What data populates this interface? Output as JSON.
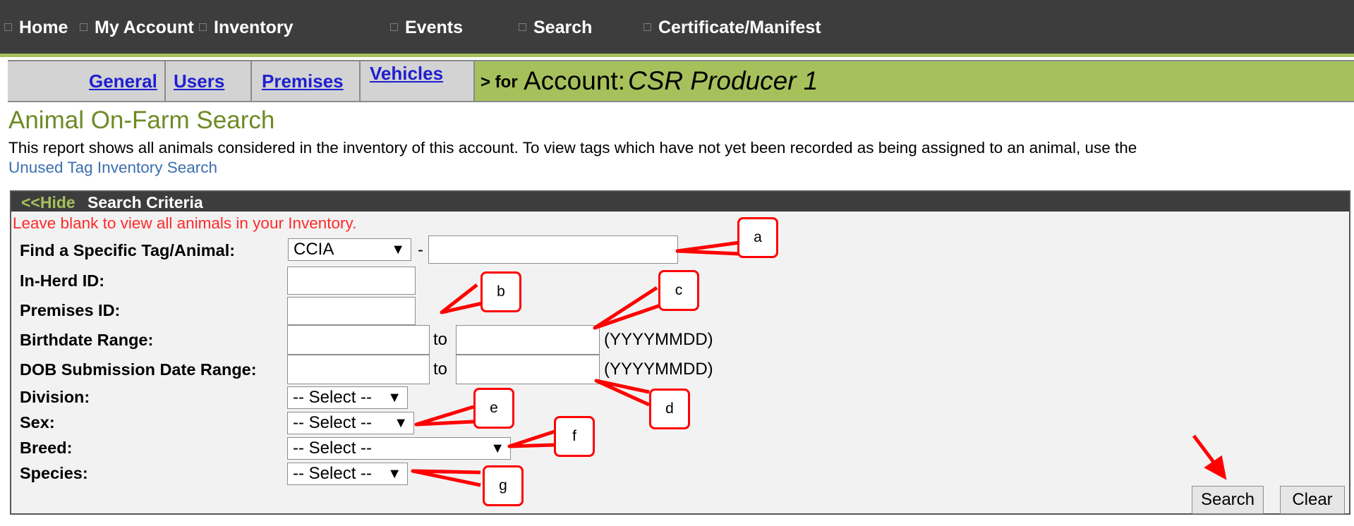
{
  "topnav": {
    "items": [
      {
        "label": "Home"
      },
      {
        "label": "My Account"
      },
      {
        "label": "Inventory"
      },
      {
        "label": "Events"
      },
      {
        "label": "Search"
      },
      {
        "label": "Certificate/Manifest"
      }
    ]
  },
  "subnav": {
    "tabs": [
      {
        "label": "General"
      },
      {
        "label": "Users"
      },
      {
        "label": "Premises"
      },
      {
        "label": "Vehicles"
      }
    ],
    "for_label": "> for",
    "account_label": "Account:",
    "account_name": "CSR Producer 1"
  },
  "page": {
    "title": "Animal On-Farm Search",
    "description": "This report shows all animals considered in the inventory of this account. To view tags which have not yet been recorded as being assigned to an animal, use the",
    "link": "Unused Tag Inventory Search"
  },
  "panel": {
    "hide_toggle": "<<Hide",
    "header": "Search Criteria",
    "notice": "Leave blank to view all animals in your Inventory.",
    "fields": {
      "tag": {
        "label": "Find a Specific Tag/Animal:",
        "type_value": "CCIA",
        "separator": "-",
        "value": ""
      },
      "inherd": {
        "label": "In-Herd ID:",
        "value": ""
      },
      "premises": {
        "label": "Premises ID:",
        "value": ""
      },
      "birthdate": {
        "label": "Birthdate Range:",
        "to": "to",
        "format": "(YYYYMMDD)"
      },
      "dob_submission": {
        "label": "DOB Submission Date Range:",
        "to": "to",
        "format": "(YYYYMMDD)"
      },
      "division": {
        "label": "Division:",
        "value": "-- Select --"
      },
      "sex": {
        "label": "Sex:",
        "value": "-- Select --"
      },
      "breed": {
        "label": "Breed:",
        "value": "-- Select --"
      },
      "species": {
        "label": "Species:",
        "value": "-- Select --"
      }
    },
    "buttons": {
      "search": "Search",
      "clear": "Clear"
    },
    "arrow_glyph": "▼"
  },
  "callouts": [
    "a",
    "b",
    "c",
    "d",
    "e",
    "f",
    "g"
  ],
  "colors": {
    "nav_bg": "#3d3d3d",
    "accent_green": "#a6c15c",
    "title_green": "#6f8a25",
    "link_blue": "#1f1fd1",
    "notice_red": "#ff2a2a",
    "callout_red": "#ff0000"
  }
}
